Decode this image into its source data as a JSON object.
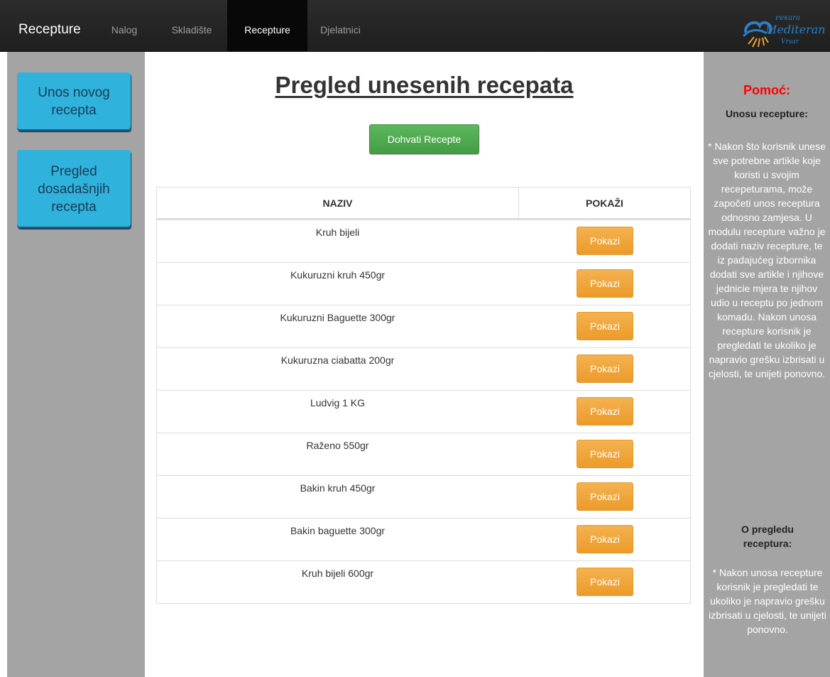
{
  "nav": {
    "brand": "Recepture",
    "items": [
      {
        "label": "Nalog",
        "active": false
      },
      {
        "label": "Skladište",
        "active": false
      },
      {
        "label": "Recepture",
        "active": true
      },
      {
        "label": "Djelatnici",
        "active": false
      }
    ],
    "logo": {
      "line1": "Pekara",
      "line2": "Mediteran",
      "line3": "Vrsar"
    }
  },
  "left_sidebar": {
    "buttons": [
      {
        "label": "Unos novog recepta"
      },
      {
        "label": "Pregled dosadašnjih recepta"
      }
    ]
  },
  "main": {
    "title": "Pregled unesenih recepata",
    "fetch_button": "Dohvati Recepte",
    "table": {
      "columns": [
        "NAZIV",
        "POKAŽI"
      ],
      "rows": [
        {
          "name": "Kruh bijeli",
          "action": "Pokazi"
        },
        {
          "name": "Kukuruzni kruh 450gr",
          "action": "Pokazi"
        },
        {
          "name": "Kukuruzni Baguette 300gr",
          "action": "Pokazi"
        },
        {
          "name": "Kukuruzna ciabatta 200gr",
          "action": "Pokazi"
        },
        {
          "name": "Ludvig 1 KG",
          "action": "Pokazi"
        },
        {
          "name": "Raženo 550gr",
          "action": "Pokazi"
        },
        {
          "name": "Bakin kruh 450gr",
          "action": "Pokazi"
        },
        {
          "name": "Bakin baguette 300gr",
          "action": "Pokazi"
        },
        {
          "name": "Kruh bijeli 600gr",
          "action": "Pokazi"
        }
      ]
    }
  },
  "help": {
    "title": "Pomoć:",
    "section1_title": "Unosu recepture:",
    "section1_text": "* Nakon što korisnik unese sve potrebne artikle koje koristi u svojim recepeturama, može započeti unos receptura odnosno zamjesa. U modulu recepture važno je dodati naziv recepture, te iz padajućeg izbornika dodati sve artikle i njihove jednicie mjera te njihov udio u receptu po jednom komadu. Nakon unosa recepture korisnik je pregledati te ukoliko je napravio grešku izbrisati u cjelosti, te unijeti ponovno.",
    "section2_title": "O pregledu receptura:",
    "section2_text": "* Nakon unosa recepture korisnik je pregledati te ukoliko je napravio grešku izbrisati u cjelosti, te unijeti ponovno."
  },
  "colors": {
    "navbar": "#222222",
    "sidebar": "#a4a4a4",
    "side_button": "#2fb3dc",
    "success": "#5cb85c",
    "warning": "#f0ad4e",
    "help_title": "#ff0000"
  }
}
